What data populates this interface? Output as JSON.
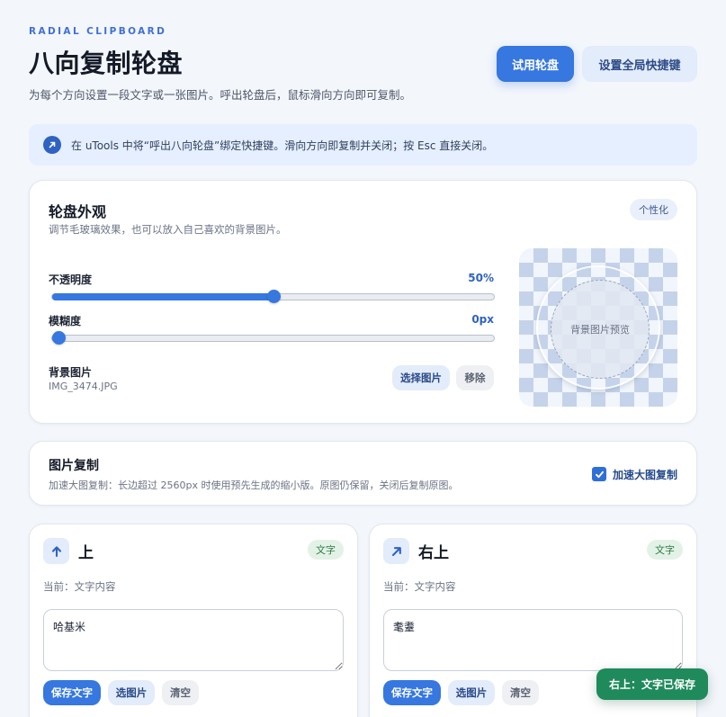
{
  "header": {
    "eyebrow": "RADIAL CLIPBOARD",
    "title": "八向复制轮盘",
    "subtitle": "为每个方向设置一段文字或一张图片。呼出轮盘后，鼠标滑向方向即可复制。",
    "try_button": "试用轮盘",
    "hotkey_button": "设置全局快捷键"
  },
  "notice": {
    "text": "在 uTools 中将“呼出八向轮盘”绑定快捷键。滑向方向即复制并关闭；按 Esc 直接关闭。",
    "icon": "arrow-up-right-icon"
  },
  "appearance": {
    "title": "轮盘外观",
    "desc": "调节毛玻璃效果，也可以放入自己喜欢的背景图片。",
    "tag": "个性化",
    "opacity": {
      "label": "不透明度",
      "value_text": "50%",
      "fraction": 0.5
    },
    "blur": {
      "label": "模糊度",
      "value_text": "0px",
      "fraction": 0.0
    },
    "background": {
      "label": "背景图片",
      "filename": "IMG_3474.JPG",
      "choose_button": "选择图片",
      "remove_button": "移除"
    },
    "preview_placeholder": "背景图片预览"
  },
  "image_copy": {
    "title": "图片复制",
    "desc": "加速大图复制：长边超过 2560px 时使用预先生成的缩小版。原图仍保留，关闭后复制原图。",
    "checkbox_label": "加速大图复制",
    "checked": true
  },
  "directions": [
    {
      "name": "上",
      "icon": "arrow-up-icon",
      "type_tag": "文字",
      "current": "当前：文字内容",
      "text": "哈基米",
      "save_button": "保存文字",
      "image_button": "选图片",
      "clear_button": "清空"
    },
    {
      "name": "右上",
      "icon": "arrow-up-right-icon",
      "type_tag": "文字",
      "current": "当前：文字内容",
      "text": "耄耋",
      "save_button": "保存文字",
      "image_button": "选图片",
      "clear_button": "清空"
    }
  ],
  "toast": {
    "text": "右上：文字已保存"
  },
  "colors": {
    "accent": "#3677e0",
    "success": "#1f8a5c",
    "page_bg": "#f3f6fb"
  }
}
